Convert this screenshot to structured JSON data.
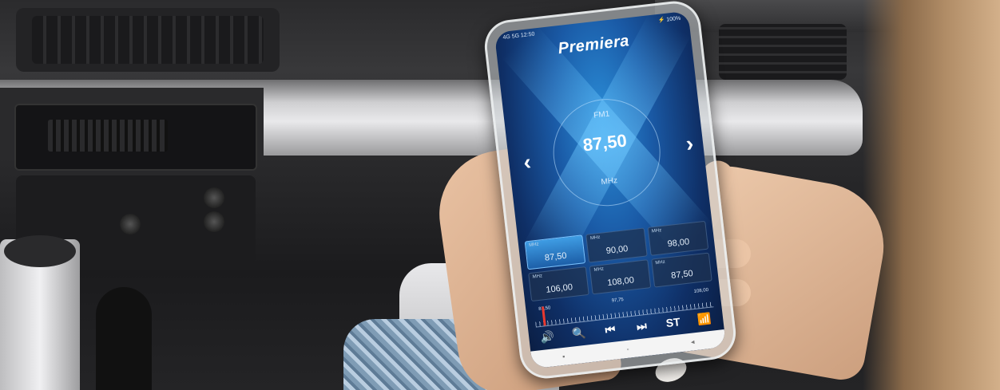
{
  "status_bar": {
    "left": "4G 5G 12:50",
    "right": "⚡ 100%"
  },
  "brand": "Premiera",
  "radio": {
    "band": "FM1",
    "frequency": "87,50",
    "unit": "MHz"
  },
  "presets": [
    {
      "tag": "MHz",
      "value": "87,50",
      "active": true
    },
    {
      "tag": "MHz",
      "value": "90,00",
      "active": false
    },
    {
      "tag": "MHz",
      "value": "98,00",
      "active": false
    },
    {
      "tag": "MHz",
      "value": "106,00",
      "active": false
    },
    {
      "tag": "MHz",
      "value": "108,00",
      "active": false
    },
    {
      "tag": "MHz",
      "value": "87,50",
      "active": false
    }
  ],
  "scale_labels": [
    "87,50",
    "97,75",
    "108,00"
  ],
  "controls": {
    "volume": "🔊",
    "search": "🔍",
    "prev": "⏮",
    "next": "⏭",
    "stereo": "ST",
    "rds": "📶"
  },
  "nav": {
    "recent": "▪",
    "home": "◦",
    "back": "◂"
  },
  "icons": [
    "chevron-left-icon",
    "chevron-right-icon",
    "volume-icon",
    "search-icon",
    "previous-icon",
    "next-icon",
    "stereo-icon",
    "signal-icon"
  ],
  "colors": {
    "accent": "#3f9de4",
    "needle": "#e8382f",
    "screen_bg": "#0f2f66"
  }
}
